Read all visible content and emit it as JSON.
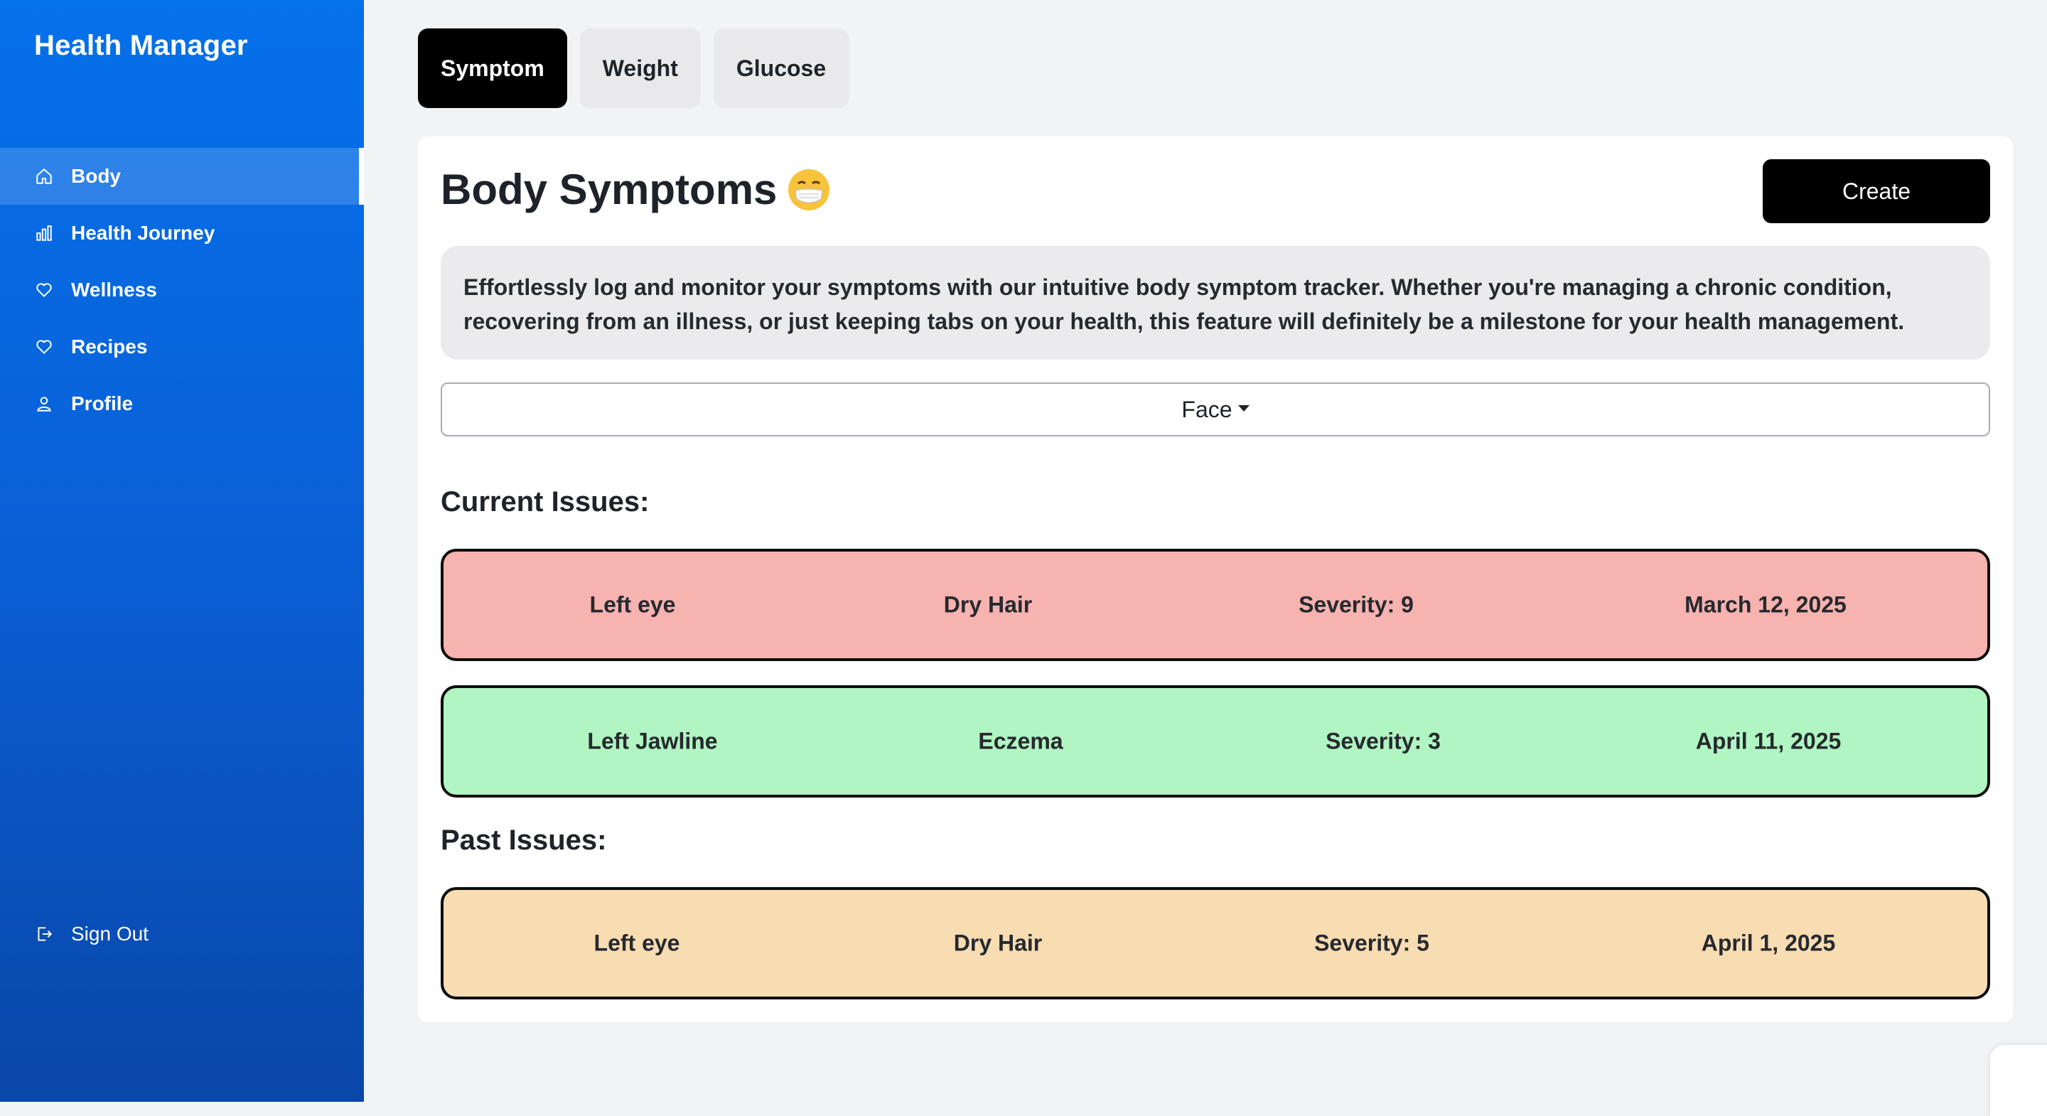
{
  "app": {
    "title": "Health Manager"
  },
  "sidebar": {
    "items": [
      {
        "label": "Body",
        "icon": "home-icon",
        "active": true
      },
      {
        "label": "Health Journey",
        "icon": "bar-chart-icon",
        "active": false
      },
      {
        "label": "Wellness",
        "icon": "heart-icon",
        "active": false
      },
      {
        "label": "Recipes",
        "icon": "heart-icon",
        "active": false
      },
      {
        "label": "Profile",
        "icon": "user-icon",
        "active": false
      }
    ],
    "signout": {
      "label": "Sign Out",
      "icon": "sign-out-icon"
    }
  },
  "tabs": [
    {
      "label": "Symptom",
      "active": true
    },
    {
      "label": "Weight",
      "active": false
    },
    {
      "label": "Glucose",
      "active": false
    }
  ],
  "main": {
    "title": "Body Symptoms",
    "title_emoji": "face-with-medical-mask-icon",
    "create_label": "Create",
    "description": "Effortlessly log and monitor your symptoms with our intuitive body symptom tracker. Whether you're managing a chronic condition, recovering from an illness, or just keeping tabs on your health, this feature will definitely be a milestone for your health management.",
    "body_part_select": {
      "value": "Face"
    },
    "current_label": "Current Issues:",
    "past_label": "Past Issues:",
    "current_issues": [
      {
        "location": "Left eye",
        "symptom": "Dry Hair",
        "severity": "Severity: 9",
        "date": "March 12, 2025",
        "color": "#f6b3b0"
      },
      {
        "location": "Left Jawline",
        "symptom": "Eczema",
        "severity": "Severity: 3",
        "date": "April 11, 2025",
        "color": "#b0f5c2"
      }
    ],
    "past_issues": [
      {
        "location": "Left eye",
        "symptom": "Dry Hair",
        "severity": "Severity: 5",
        "date": "April 1, 2025",
        "color": "#f8dcb2"
      }
    ]
  },
  "colors": {
    "sidebar_top": "#0571ea",
    "sidebar_bottom": "#0947a8",
    "active_tab": "#000000",
    "page_bg": "#f2f3f5"
  }
}
